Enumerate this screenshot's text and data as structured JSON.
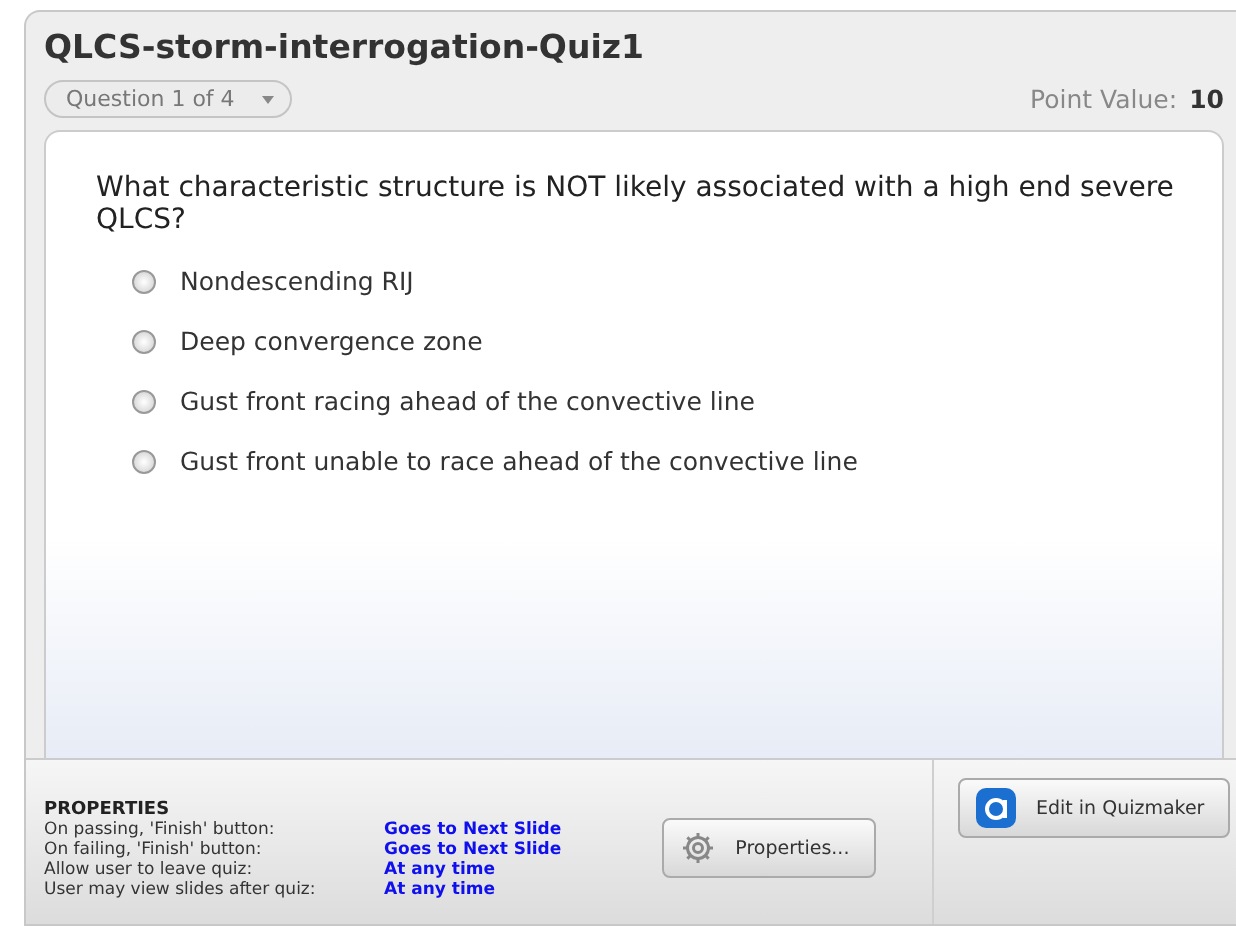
{
  "quiz": {
    "title": "QLCS-storm-interrogation-Quiz1",
    "question_selector": "Question 1 of 4",
    "point_value_label": "Point Value:",
    "point_value": "10"
  },
  "question": {
    "text": "What characteristic structure is NOT likely associated with a high end severe QLCS?",
    "options": [
      {
        "label": "Nondescending RIJ",
        "selected": false
      },
      {
        "label": "Deep convergence zone",
        "selected": false
      },
      {
        "label": "Gust front racing ahead of the convective line",
        "selected": false
      },
      {
        "label": "Gust front unable to race ahead of the convective line",
        "selected": false
      }
    ]
  },
  "properties": {
    "heading": "PROPERTIES",
    "rows": [
      {
        "label": "On passing, 'Finish' button:",
        "value": "Goes to Next Slide"
      },
      {
        "label": "On failing, 'Finish' button:",
        "value": "Goes to Next Slide"
      },
      {
        "label": "Allow user to leave quiz:",
        "value": "At any time"
      },
      {
        "label": "User may view slides after quiz:",
        "value": "At any time"
      }
    ],
    "buttons": [
      {
        "kind": "properties",
        "label": "Properties..."
      },
      {
        "kind": "quizmaker",
        "label": "Edit in Quizmaker"
      }
    ]
  }
}
